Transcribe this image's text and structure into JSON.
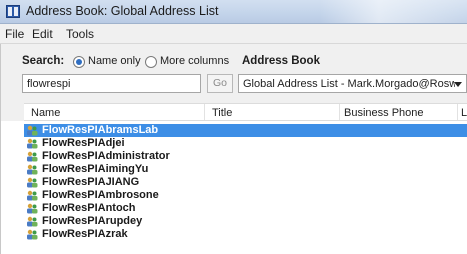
{
  "window": {
    "title": "Address Book: Global Address List"
  },
  "menu": {
    "items": [
      "File",
      "Edit",
      "Tools"
    ]
  },
  "search": {
    "label": "Search:",
    "option_name_only": "Name only",
    "option_more_columns": "More columns",
    "selected_option": "Name only",
    "input_value": "flowrespi",
    "go_label": "Go"
  },
  "address_book": {
    "label": "Address Book",
    "selected_value": "Global Address List - Mark.Morgado@RoswellP"
  },
  "columns": {
    "name": "Name",
    "title": "Title",
    "business_phone": "Business Phone",
    "location": "L"
  },
  "results": [
    "FlowResPIAbramsLab",
    "FlowResPIAdjei",
    "FlowResPIAdministrator",
    "FlowResPIAimingYu",
    "FlowResPIAJIANG",
    "FlowResPIAmbrosone",
    "FlowResPIAntoch",
    "FlowResPIArupdey",
    "FlowResPIAzrak"
  ],
  "selected_result": "FlowResPIAbramsLab",
  "colors": {
    "selection": "#3d8ee6",
    "titlebar": "#c3d4ea"
  }
}
